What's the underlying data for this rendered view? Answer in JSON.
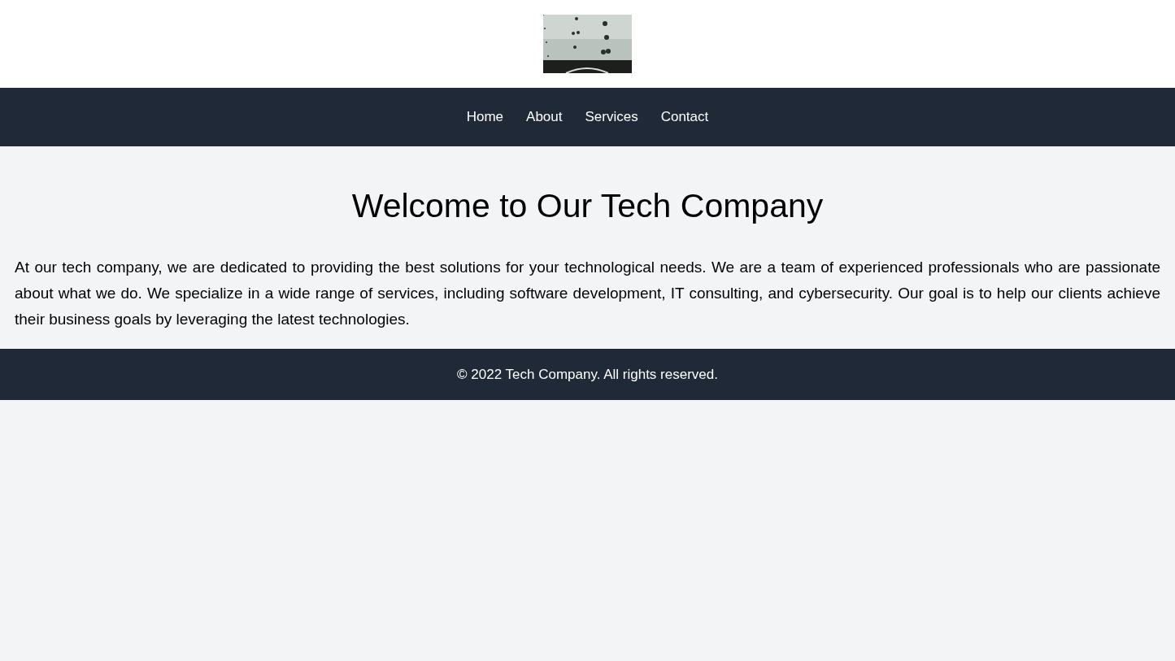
{
  "nav": {
    "links": [
      {
        "label": "Home"
      },
      {
        "label": "About"
      },
      {
        "label": "Services"
      },
      {
        "label": "Contact"
      }
    ]
  },
  "main": {
    "heading": "Welcome to Our Tech Company",
    "paragraph": "At our tech company, we are dedicated to providing the best solutions for your technological needs. We are a team of experienced professionals who are passionate about what we do. We specialize in a wide range of services, including software development, IT consulting, and cybersecurity. Our goal is to help our clients achieve their business goals by leveraging the latest technologies."
  },
  "footer": {
    "text": "© 2022 Tech Company. All rights reserved."
  }
}
